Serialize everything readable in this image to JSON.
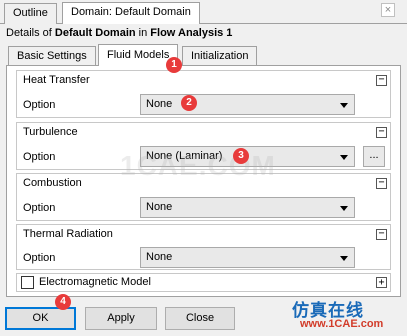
{
  "top_tabs": [
    {
      "label": "Outline"
    },
    {
      "label": "Domain: Default Domain"
    }
  ],
  "close_glyph": "×",
  "details": {
    "prefix": "Details of ",
    "object": "Default Domain",
    "middle": " in ",
    "context": "Flow Analysis 1"
  },
  "inner_tabs": [
    {
      "label": "Basic Settings"
    },
    {
      "label": "Fluid Models"
    },
    {
      "label": "Initialization"
    }
  ],
  "groups": {
    "heat_transfer": {
      "title": "Heat Transfer",
      "option_label": "Option",
      "value": "None"
    },
    "turbulence": {
      "title": "Turbulence",
      "option_label": "Option",
      "value": "None (Laminar)",
      "more_label": "..."
    },
    "combustion": {
      "title": "Combustion",
      "option_label": "Option",
      "value": "None"
    },
    "thermal_radiation": {
      "title": "Thermal Radiation",
      "option_label": "Option",
      "value": "None"
    }
  },
  "electromagnetic": {
    "label": "Electromagnetic Model",
    "checked": false
  },
  "collapse_glyph": "−",
  "expand_glyph": "+",
  "buttons": {
    "ok": "OK",
    "apply": "Apply",
    "close": "Close"
  },
  "badges": {
    "b1": "1",
    "b2": "2",
    "b3": "3",
    "b4": "4"
  },
  "watermark": {
    "main": "仿真在线",
    "sub": "www.1CAE.com",
    "bg": "1CAE.COM"
  },
  "colors": {
    "badge": "#e83b3b",
    "ok_focus": "#0078d7",
    "watermark_blue": "#1a6ab8",
    "watermark_red": "#d23c2a"
  }
}
